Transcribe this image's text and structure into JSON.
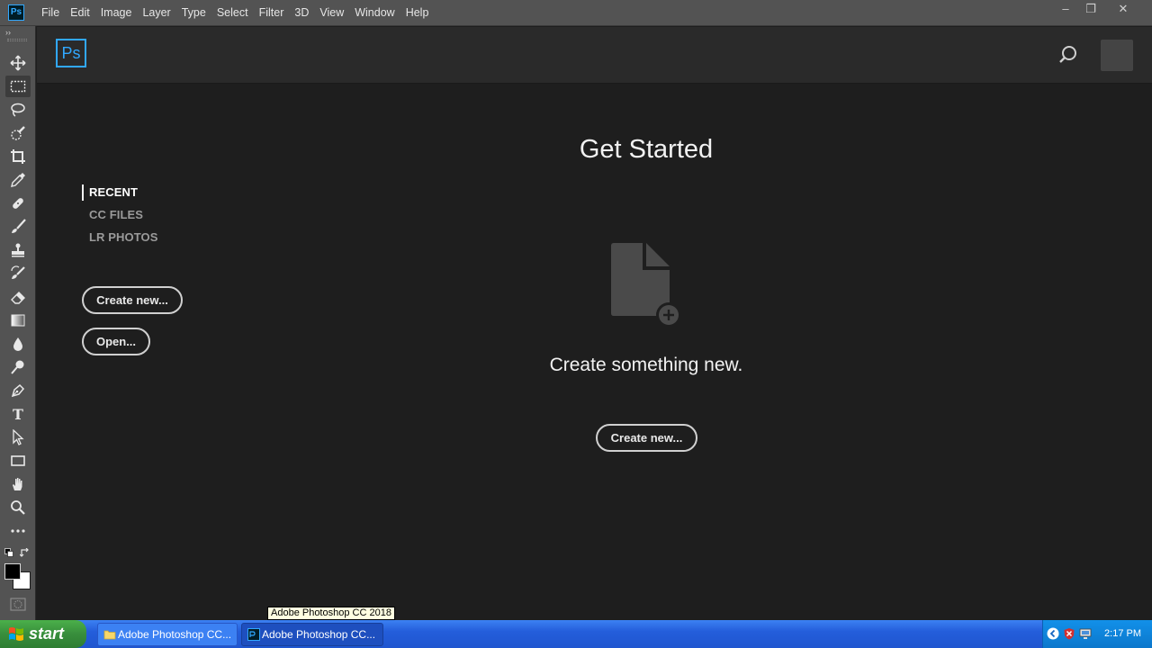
{
  "app": {
    "icon_text": "Ps"
  },
  "menu": {
    "items": [
      "File",
      "Edit",
      "Image",
      "Layer",
      "Type",
      "Select",
      "Filter",
      "3D",
      "View",
      "Window",
      "Help"
    ]
  },
  "window_controls": {
    "minimize": "–",
    "restore": "❐",
    "close": "✕"
  },
  "toolbar": {
    "tools": [
      {
        "name": "move-tool",
        "icon": "move-icon"
      },
      {
        "name": "rectangular-marquee-tool",
        "icon": "marquee-icon",
        "active": true
      },
      {
        "name": "lasso-tool",
        "icon": "lasso-icon"
      },
      {
        "name": "quick-selection-tool",
        "icon": "quick-selection-icon"
      },
      {
        "name": "crop-tool",
        "icon": "crop-icon"
      },
      {
        "name": "eyedropper-tool",
        "icon": "eyedropper-icon"
      },
      {
        "name": "healing-brush-tool",
        "icon": "bandage-icon"
      },
      {
        "name": "brush-tool",
        "icon": "brush-icon"
      },
      {
        "name": "clone-stamp-tool",
        "icon": "stamp-icon"
      },
      {
        "name": "history-brush-tool",
        "icon": "history-brush-icon"
      },
      {
        "name": "eraser-tool",
        "icon": "eraser-icon"
      },
      {
        "name": "gradient-tool",
        "icon": "gradient-icon"
      },
      {
        "name": "blur-tool",
        "icon": "drop-icon"
      },
      {
        "name": "dodge-tool",
        "icon": "dodge-icon"
      },
      {
        "name": "pen-tool",
        "icon": "pen-icon"
      },
      {
        "name": "type-tool",
        "icon": "type-icon",
        "text": "T"
      },
      {
        "name": "path-selection-tool",
        "icon": "arrow-icon"
      },
      {
        "name": "rectangle-tool",
        "icon": "rectangle-icon"
      },
      {
        "name": "hand-tool",
        "icon": "hand-icon"
      },
      {
        "name": "zoom-tool",
        "icon": "zoom-icon"
      },
      {
        "name": "edit-toolbar",
        "icon": "more-icon"
      }
    ],
    "foreground_color": "#000000",
    "background_color": "#ffffff"
  },
  "start": {
    "logo_text": "Ps",
    "nav": [
      {
        "label": "RECENT",
        "active": true
      },
      {
        "label": "CC FILES",
        "active": false
      },
      {
        "label": "LR PHOTOS",
        "active": false
      }
    ],
    "create_new_label": "Create new...",
    "open_label": "Open...",
    "title": "Get Started",
    "subtitle": "Create something new.",
    "center_create_label": "Create new..."
  },
  "taskbar": {
    "start_label": "start",
    "tooltip": "Adobe Photoshop CC 2018",
    "tasks": [
      {
        "label": "Adobe Photoshop CC...",
        "icon": "folder-icon"
      },
      {
        "label": "Adobe Photoshop CC...",
        "icon": "ps-icon"
      }
    ],
    "clock": "2:17 PM"
  },
  "colors": {
    "accent": "#31a8ff",
    "panel": "#535353",
    "workspace": "#1e1e1e",
    "taskbar": "#245edb",
    "start_green": "#388e3c"
  }
}
